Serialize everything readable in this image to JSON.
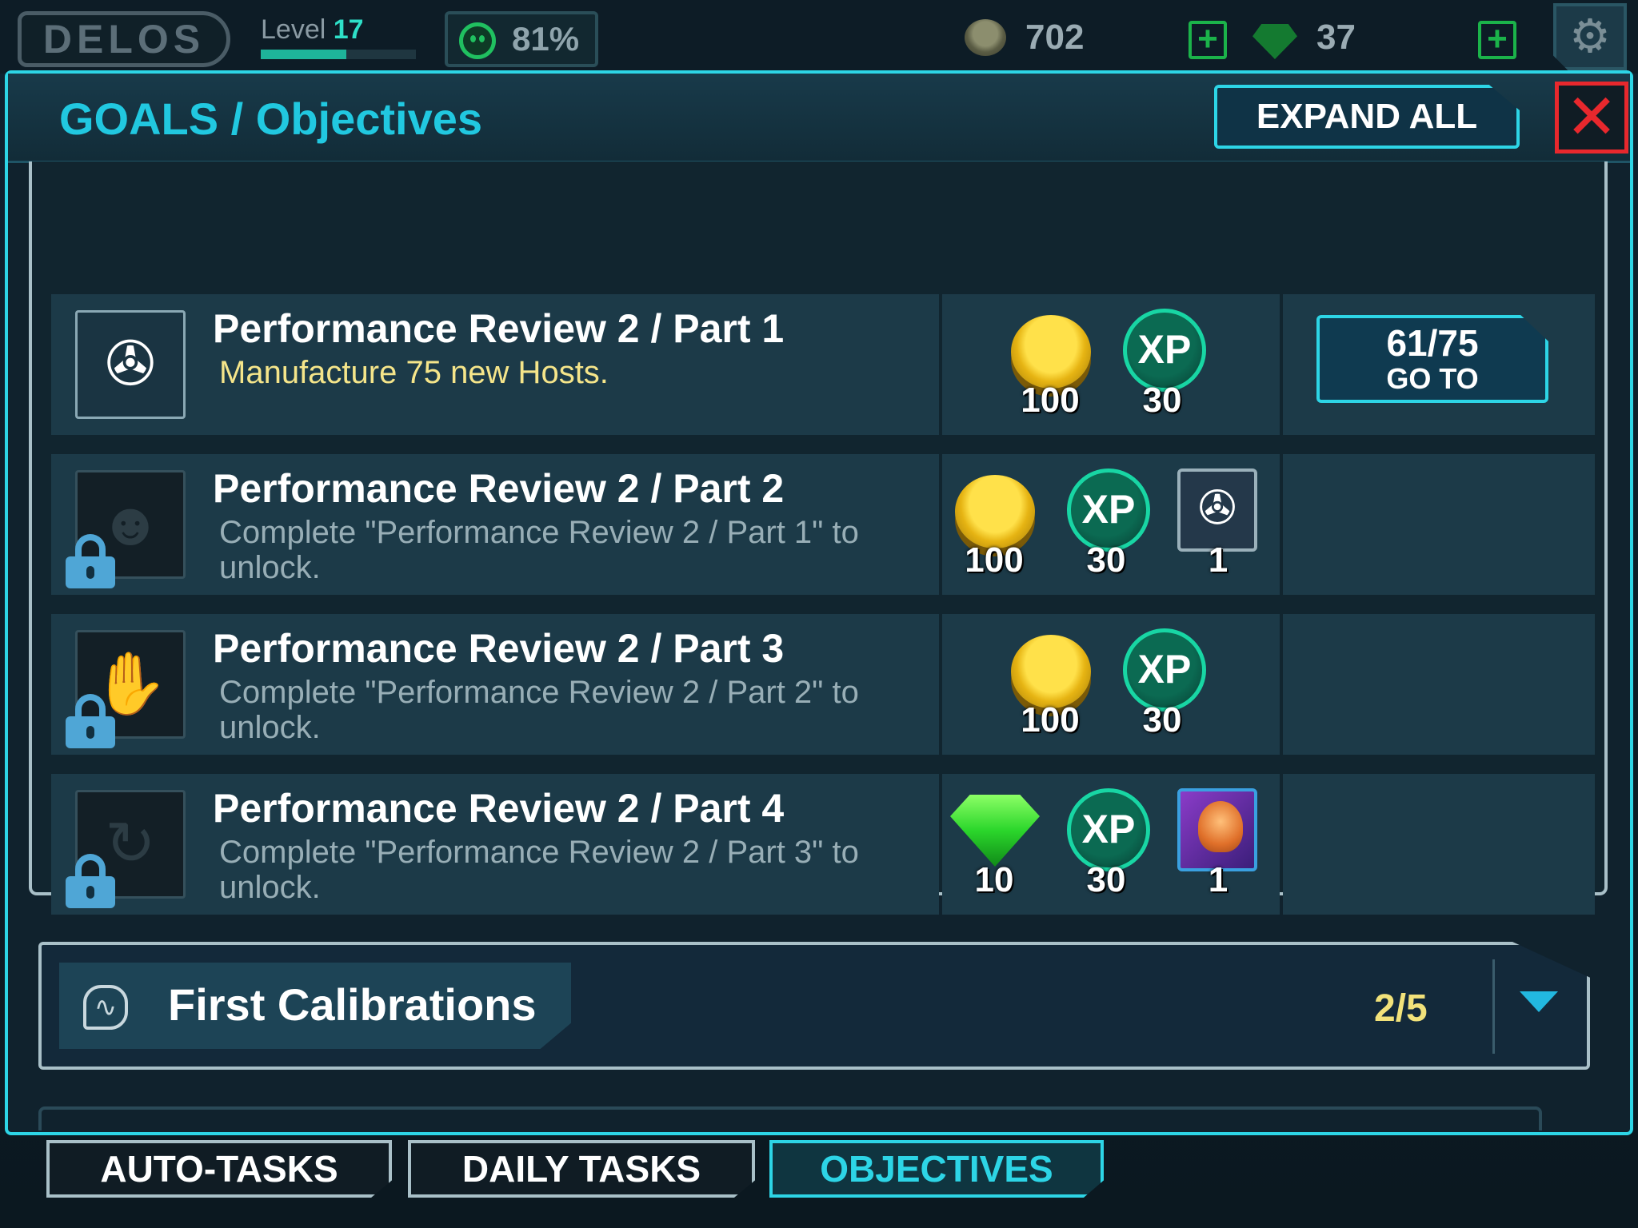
{
  "topbar": {
    "brand": "DELOS",
    "level_label": "Level",
    "level_value": "17",
    "level_progress": 0.55,
    "happiness": "81%",
    "coins": "702",
    "gems": "37",
    "icons": [
      "happy-face-icon",
      "coin-icon",
      "plus-icon",
      "gem-icon",
      "gear-icon"
    ]
  },
  "panel": {
    "title": "GOALS / Objectives",
    "expand_all": "EXPAND ALL",
    "close_glyph": "✕"
  },
  "objectives": [
    {
      "title": "Performance Review 2 / Part 1",
      "description": "Manufacture 75 new Hosts.",
      "locked": false,
      "rewards": [
        {
          "type": "coin",
          "amount": "100"
        },
        {
          "type": "xp",
          "label": "XP",
          "amount": "30"
        }
      ],
      "progress": "61/75",
      "action": "GO TO"
    },
    {
      "title": "Performance Review 2 / Part 2",
      "description": "Complete \"Performance Review 2 / Part 1\" to unlock.",
      "locked": true,
      "rewards": [
        {
          "type": "coin",
          "amount": "100"
        },
        {
          "type": "xp",
          "label": "XP",
          "amount": "30"
        },
        {
          "type": "host-card",
          "amount": "1"
        }
      ]
    },
    {
      "title": "Performance Review 2 / Part 3",
      "description": "Complete \"Performance Review 2 / Part 2\" to unlock.",
      "locked": true,
      "rewards": [
        {
          "type": "coin",
          "amount": "100"
        },
        {
          "type": "xp",
          "label": "XP",
          "amount": "30"
        }
      ]
    },
    {
      "title": "Performance Review 2 / Part 4",
      "description": "Complete \"Performance Review 2 / Part 3\" to unlock.",
      "locked": true,
      "rewards": [
        {
          "type": "gem",
          "amount": "10"
        },
        {
          "type": "xp",
          "label": "XP",
          "amount": "30"
        },
        {
          "type": "purple-card",
          "amount": "1"
        }
      ]
    }
  ],
  "calibrations": {
    "title": "First Calibrations",
    "count": "2/5"
  },
  "tabs": [
    {
      "label": "AUTO-TASKS",
      "active": false
    },
    {
      "label": "DAILY TASKS",
      "active": false
    },
    {
      "label": "OBJECTIVES",
      "active": true
    }
  ],
  "colors": {
    "accent": "#2dd5e6",
    "close": "#e8282d",
    "desc_active": "#f5e58a",
    "count": "#f2e27a"
  }
}
